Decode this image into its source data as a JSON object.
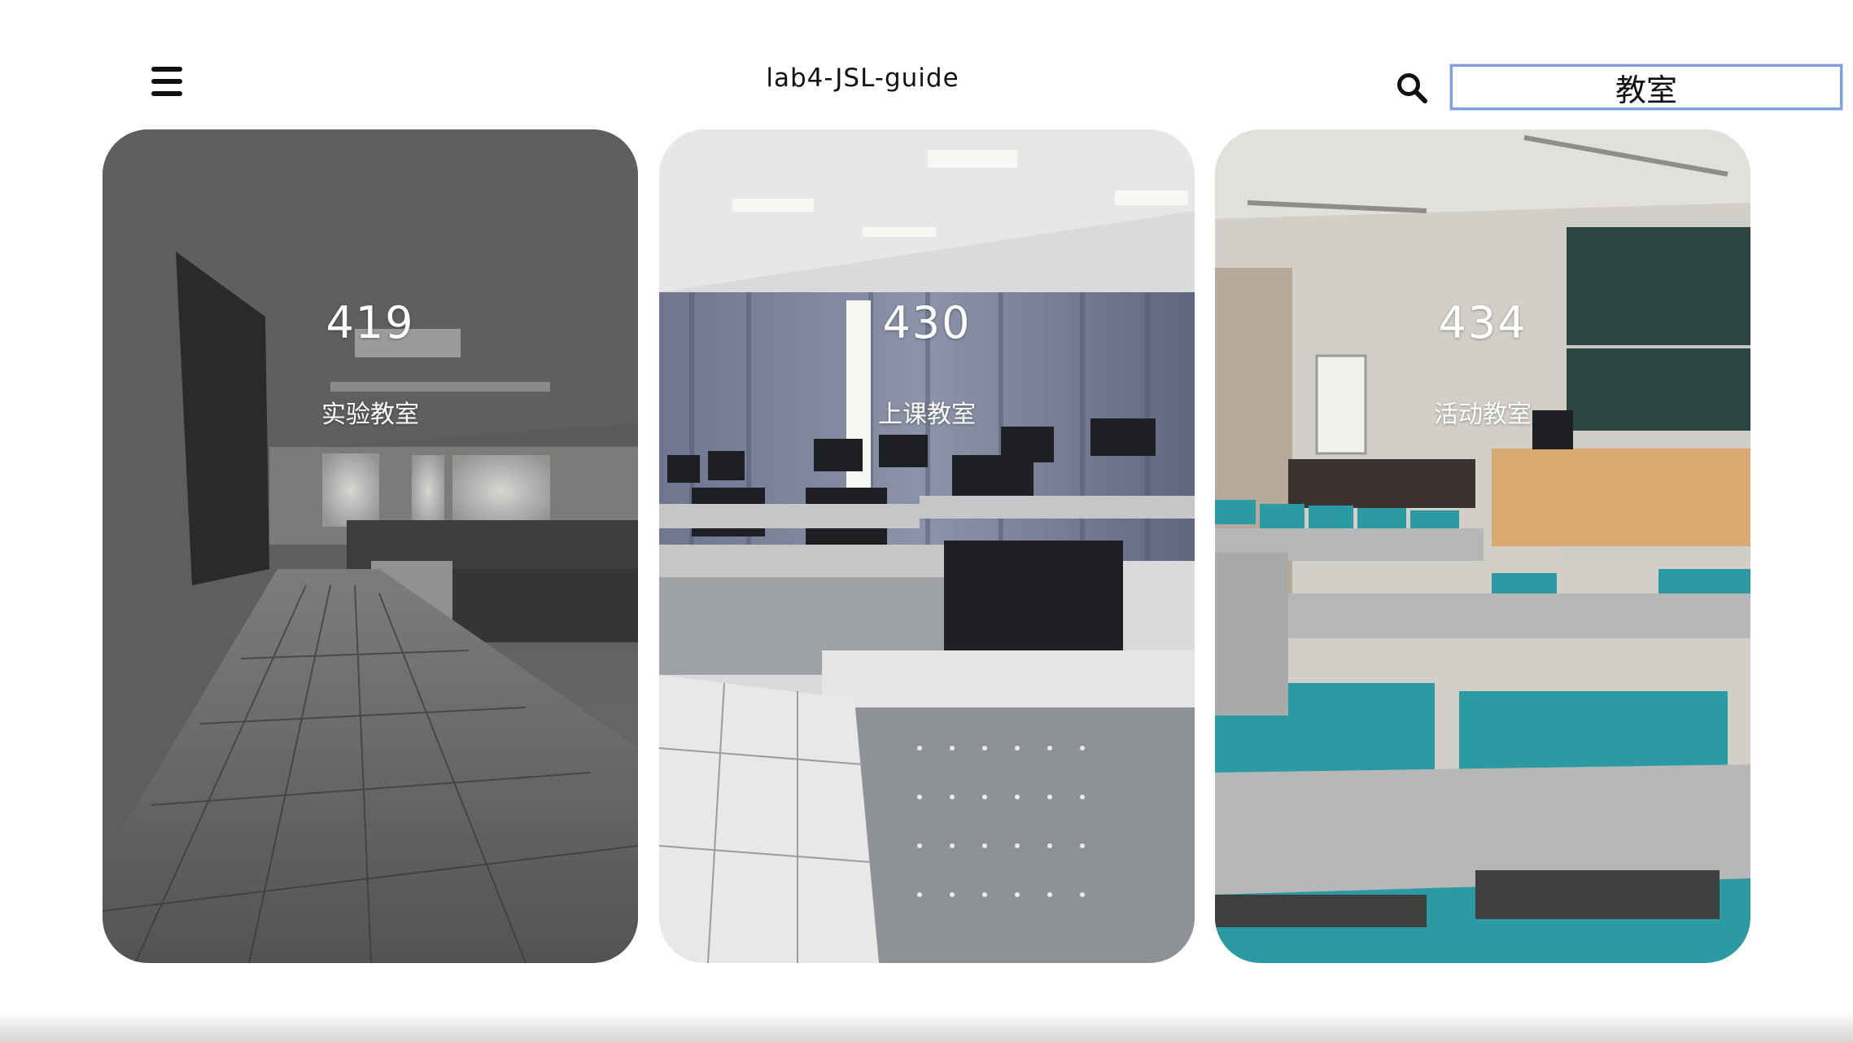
{
  "header": {
    "title": "lab4-JSL-guide",
    "menu_icon": "hamburger-menu-icon",
    "search_icon": "search-icon"
  },
  "search": {
    "value": "教室",
    "focus_color": "#7f9fe0"
  },
  "cards": [
    {
      "number": "419",
      "label": "实验教室",
      "photo": "dim laboratory classroom with tiled floor"
    },
    {
      "number": "430",
      "label": "上课教室",
      "photo": "computer classroom with grey curtains and monitors"
    },
    {
      "number": "434",
      "label": "活动教室",
      "photo": "activity classroom with teal chairs and green blackboard"
    }
  ],
  "colors": {
    "background": "#ffffff",
    "text": "#111111",
    "card_text": "#ffffff"
  }
}
